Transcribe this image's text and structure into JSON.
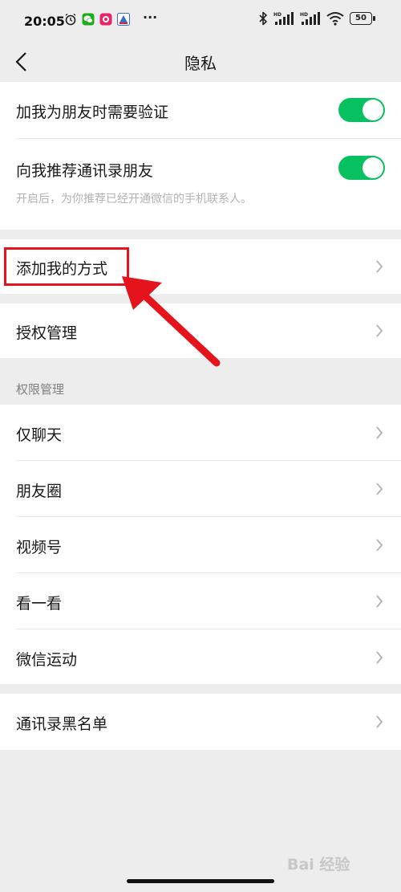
{
  "status_bar": {
    "time": "20:05",
    "dots": "···",
    "battery": "50",
    "icons": [
      "alarm-icon",
      "wechat-icon",
      "app-icon",
      "app2-icon",
      "bluetooth-icon",
      "hd-signal-icon",
      "hd-signal-icon",
      "wifi-icon",
      "battery-icon"
    ]
  },
  "nav": {
    "title": "隐私",
    "back_icon": "chevron-left-icon"
  },
  "settings": {
    "verify_friend": {
      "label": "加我为朋友时需要验证",
      "enabled": true
    },
    "recommend_contacts": {
      "label": "向我推荐通讯录朋友",
      "sub": "开启后，为你推荐已经开通微信的手机联系人。",
      "enabled": true
    },
    "add_me_methods": {
      "label": "添加我的方式"
    },
    "authorization": {
      "label": "授权管理"
    }
  },
  "permissions": {
    "header": "权限管理",
    "items": [
      {
        "label": "仅聊天"
      },
      {
        "label": "朋友圈"
      },
      {
        "label": "视频号"
      },
      {
        "label": "看一看"
      },
      {
        "label": "微信运动"
      }
    ]
  },
  "blacklist": {
    "label": "通讯录黑名单"
  },
  "watermark": "Bai 经验",
  "colors": {
    "accent": "#07c160",
    "highlight": "#e5131b",
    "background": "#ededed"
  }
}
